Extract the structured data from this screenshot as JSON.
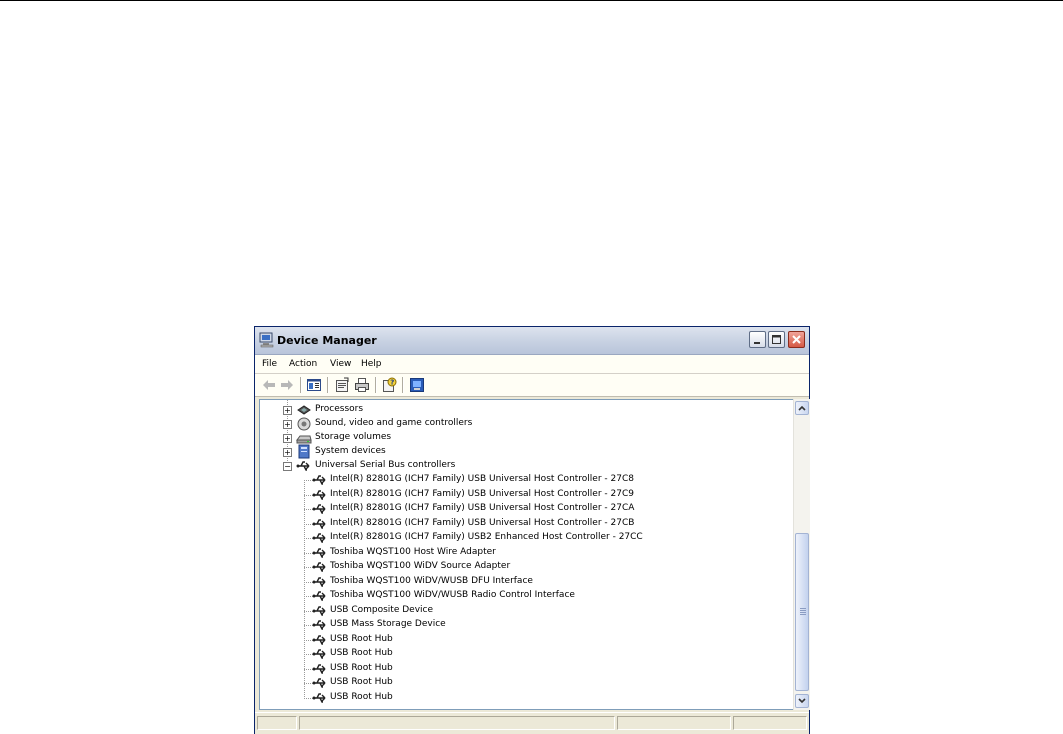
{
  "window": {
    "title": "Device Manager",
    "icon": "computer-icon",
    "controls": [
      "minimize-icon",
      "maximize-icon",
      "close-icon"
    ]
  },
  "menu": {
    "file": "File",
    "action": "Action",
    "view": "View",
    "help": "Help"
  },
  "toolbar": {
    "buttons": [
      "back-icon",
      "forward-icon",
      "show-hide-tree-icon",
      "properties-icon",
      "print-icon",
      "help-icon",
      "update-driver-icon"
    ]
  },
  "tree": {
    "categories": [
      {
        "label": "Processors",
        "icon": "processor-icon",
        "expanded": false
      },
      {
        "label": "Sound, video and game controllers",
        "icon": "sound-icon",
        "expanded": false
      },
      {
        "label": "Storage volumes",
        "icon": "storage-volume-icon",
        "expanded": false
      },
      {
        "label": "System devices",
        "icon": "system-device-icon",
        "expanded": false
      },
      {
        "label": "Universal Serial Bus controllers",
        "icon": "usb-icon",
        "expanded": true
      }
    ],
    "usb_children": [
      "Intel(R) 82801G (ICH7 Family) USB Universal Host Controller - 27C8",
      "Intel(R) 82801G (ICH7 Family) USB Universal Host Controller - 27C9",
      "Intel(R) 82801G (ICH7 Family) USB Universal Host Controller - 27CA",
      "Intel(R) 82801G (ICH7 Family) USB Universal Host Controller - 27CB",
      "Intel(R) 82801G (ICH7 Family) USB2 Enhanced Host Controller - 27CC",
      "Toshiba WQST100 Host Wire Adapter",
      "Toshiba WQST100 WiDV Source Adapter",
      "Toshiba WQST100 WiDV/WUSB DFU Interface",
      "Toshiba WQST100 WiDV/WUSB Radio Control Interface",
      "USB Composite Device",
      "USB Mass Storage Device",
      "USB Root Hub",
      "USB Root Hub",
      "USB Root Hub",
      "USB Root Hub",
      "USB Root Hub"
    ]
  },
  "scrollbar": {
    "icons": [
      "scroll-up-icon",
      "scroll-down-icon"
    ],
    "position": "bottom"
  },
  "colors": {
    "title_gradient_top": "#dde3ee",
    "window_border": "#0a246a",
    "close_button": "#d65a45",
    "chrome": "#ece9d8"
  }
}
